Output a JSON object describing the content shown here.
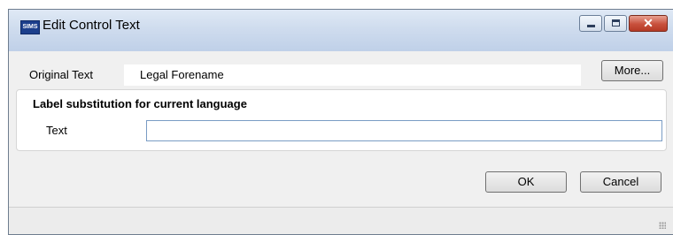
{
  "window": {
    "app_icon_text": "SIMS",
    "title": "Edit Control Text",
    "close_glyph": "✕",
    "icons": [
      "sims-app-icon",
      "minimize-icon",
      "maximize-icon",
      "close-icon",
      "resize-grip-icon"
    ]
  },
  "original": {
    "label": "Original Text",
    "value": "Legal Forename",
    "more_button": "More..."
  },
  "substitution": {
    "group_title": "Label substitution for current language",
    "text_label": "Text",
    "text_value": ""
  },
  "buttons": {
    "ok": "OK",
    "cancel": "Cancel"
  }
}
